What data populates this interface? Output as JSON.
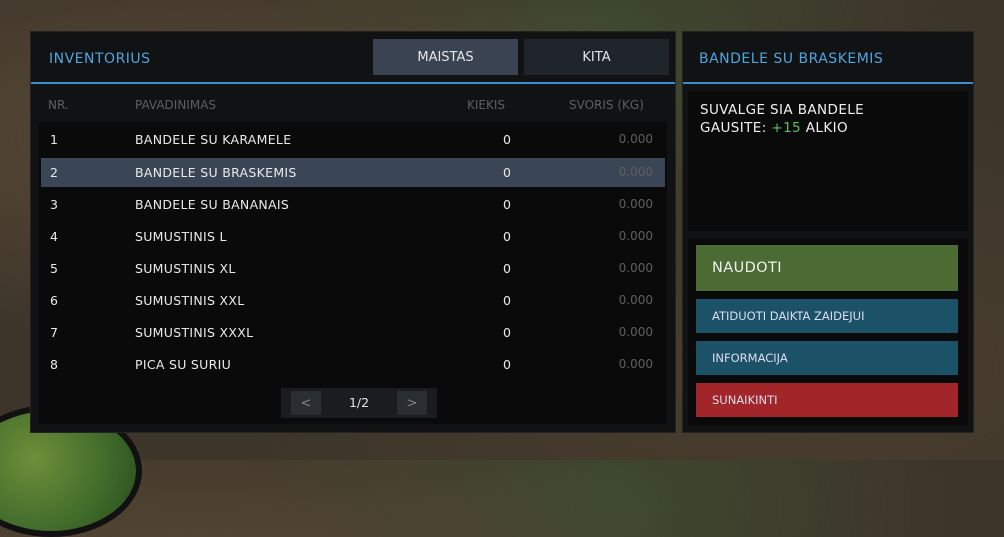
{
  "inventory": {
    "title": "INVENTORIUS",
    "tabs": [
      {
        "label": "MAISTAS",
        "active": true
      },
      {
        "label": "KITA",
        "active": false
      }
    ],
    "columns": {
      "nr": "NR.",
      "name": "PAVADINIMAS",
      "qty": "KIEKIS",
      "weight": "SVORIS (KG)"
    },
    "rows": [
      {
        "nr": "1",
        "name": "BANDELE SU KARAMELE",
        "qty": "0",
        "weight": "0.000"
      },
      {
        "nr": "2",
        "name": "BANDELE SU BRASKEMIS",
        "qty": "0",
        "weight": "0.000",
        "selected": true
      },
      {
        "nr": "3",
        "name": "BANDELE SU BANANAIS",
        "qty": "0",
        "weight": "0.000"
      },
      {
        "nr": "4",
        "name": "SUMUSTINIS L",
        "qty": "0",
        "weight": "0.000"
      },
      {
        "nr": "5",
        "name": "SUMUSTINIS XL",
        "qty": "0",
        "weight": "0.000"
      },
      {
        "nr": "6",
        "name": "SUMUSTINIS XXL",
        "qty": "0",
        "weight": "0.000"
      },
      {
        "nr": "7",
        "name": "SUMUSTINIS XXXL",
        "qty": "0",
        "weight": "0.000"
      },
      {
        "nr": "8",
        "name": "PICA SU SURIU",
        "qty": "0",
        "weight": "0.000"
      }
    ],
    "pager": {
      "prev": "<",
      "page": "1/2",
      "next": ">"
    }
  },
  "detail": {
    "title": "BANDELE SU BRASKEMIS",
    "line1": "SUVALGE SIA BANDELE",
    "line2_prefix": "GAUSITE:",
    "line2_value": "+15",
    "line2_suffix": "ALKIO",
    "buttons": {
      "use": "NAUDOTI",
      "give": "ATIDUOTI DAIKTA ZAIDEJUI",
      "info": "INFORMACIJA",
      "destroy": "SUNAIKINTI"
    }
  },
  "colors": {
    "accent": "#4ca5df",
    "use": "#4b6b33",
    "give": "#1c5268",
    "destroy": "#a12529",
    "value_green": "#5cbf5a"
  }
}
